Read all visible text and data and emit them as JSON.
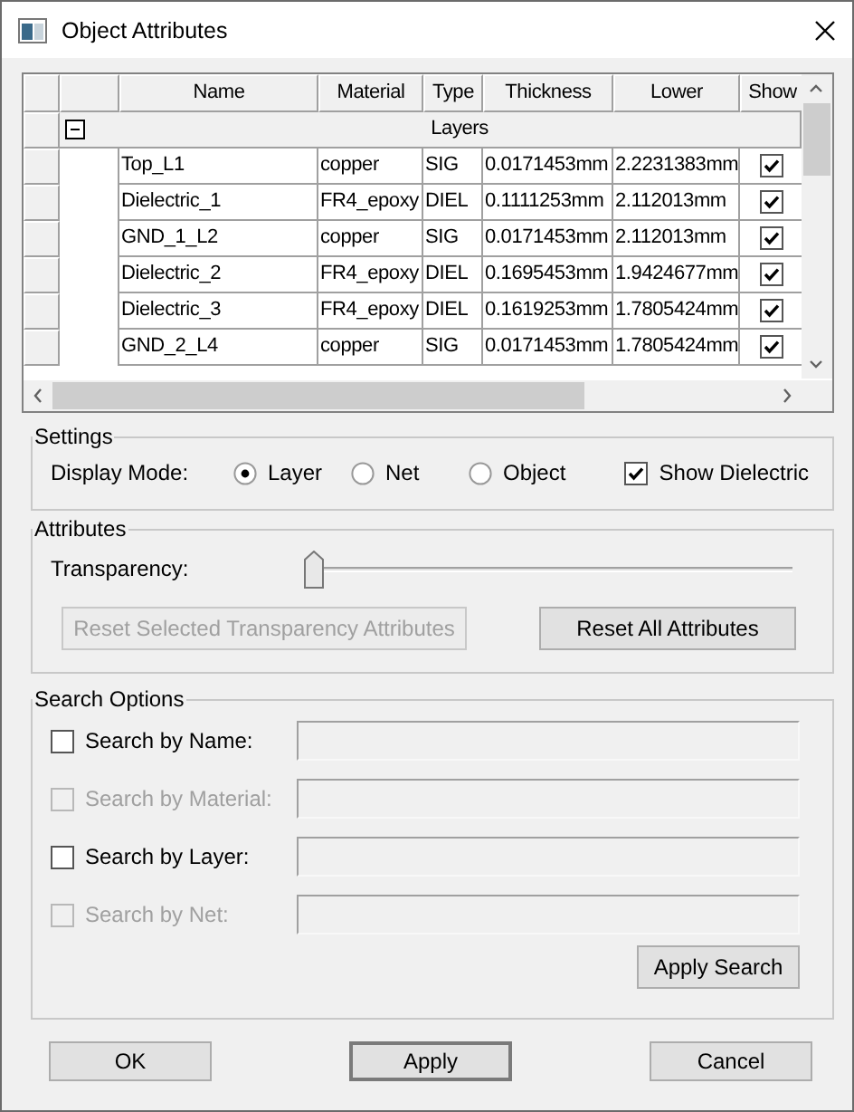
{
  "window": {
    "title": "Object Attributes"
  },
  "table": {
    "columns": [
      "Name",
      "Material",
      "Type",
      "Thickness",
      "Lower",
      "Show"
    ],
    "group": {
      "label": "Layers",
      "expanded": true
    },
    "rows": [
      {
        "name": "Top_L1",
        "material": "copper",
        "type": "SIG",
        "thickness": "0.0171453mm",
        "lower": "2.2231383mm",
        "show": true
      },
      {
        "name": "Dielectric_1",
        "material": "FR4_epoxy",
        "type": "DIEL",
        "thickness": "0.1111253mm",
        "lower": "2.112013mm",
        "show": true
      },
      {
        "name": "GND_1_L2",
        "material": "copper",
        "type": "SIG",
        "thickness": "0.0171453mm",
        "lower": "2.112013mm",
        "show": true
      },
      {
        "name": "Dielectric_2",
        "material": "FR4_epoxy",
        "type": "DIEL",
        "thickness": "0.1695453mm",
        "lower": "1.9424677mm",
        "show": true
      },
      {
        "name": "Dielectric_3",
        "material": "FR4_epoxy",
        "type": "DIEL",
        "thickness": "0.1619253mm",
        "lower": "1.7805424mm",
        "show": true
      },
      {
        "name": "GND_2_L4",
        "material": "copper",
        "type": "SIG",
        "thickness": "0.0171453mm",
        "lower": "1.7805424mm",
        "show": true
      }
    ]
  },
  "settings": {
    "title": "Settings",
    "display_mode_label": "Display Mode:",
    "modes": [
      {
        "label": "Layer",
        "selected": true
      },
      {
        "label": "Net",
        "selected": false
      },
      {
        "label": "Object",
        "selected": false
      }
    ],
    "show_dielectric": {
      "label": "Show Dielectric",
      "checked": true
    }
  },
  "attributes": {
    "title": "Attributes",
    "transparency_label": "Transparency:",
    "level": 0,
    "buttons": [
      {
        "label": "Reset Selected Transparency Attributes",
        "disabled": true
      },
      {
        "label": "Reset All Attributes",
        "disabled": false
      }
    ]
  },
  "search": {
    "title": "Search Options",
    "fields": [
      {
        "label": "Search by Name:",
        "checked": false,
        "disabled": false
      },
      {
        "label": "Search by Material:",
        "checked": false,
        "disabled": true
      },
      {
        "label": "Search by Layer:",
        "checked": false,
        "disabled": false
      },
      {
        "label": "Search by Net:",
        "checked": false,
        "disabled": true
      }
    ],
    "apply_button": "Apply Search"
  },
  "buttons": [
    {
      "label": "OK",
      "default": false
    },
    {
      "label": "Apply",
      "default": true
    },
    {
      "label": "Cancel",
      "default": false
    }
  ]
}
